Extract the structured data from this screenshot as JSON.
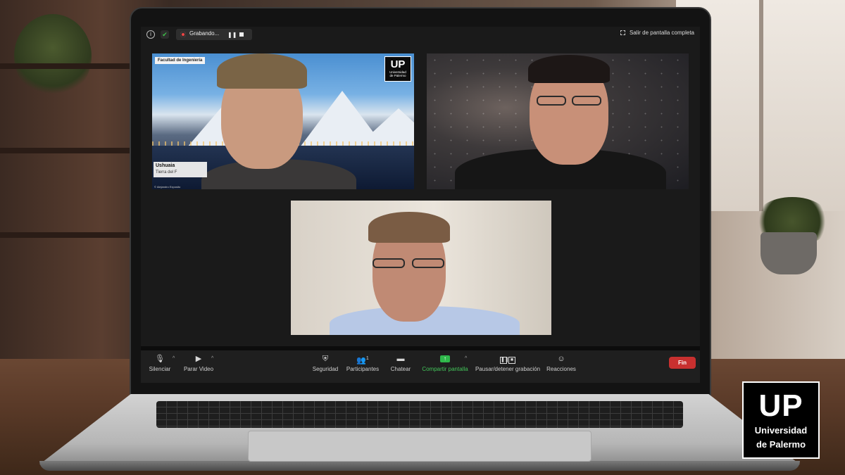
{
  "topbar": {
    "recording_label": "Grabando...",
    "exit_fullscreen_label": "Salir de pantalla completa"
  },
  "tiles": {
    "host_overlay": {
      "faculty_label": "Facultad de Ingeniería",
      "logo_mark": "UP",
      "logo_name_line1": "Universidad",
      "logo_name_line2": "de Palermo",
      "place_title": "Ushuaia",
      "place_subtitle": "Tierra del F",
      "photo_credit": "© Alejandro Exposito"
    }
  },
  "toolbar": {
    "mute_label": "Silenciar",
    "stop_video_label": "Parar Video",
    "security_label": "Seguridad",
    "participants_label": "Participantes",
    "participants_count": "1",
    "chat_label": "Chatear",
    "share_label": "Compartir pantalla",
    "pause_recording_label": "Pausar/detener grabación",
    "reactions_label": "Reacciones",
    "end_label": "Fin"
  },
  "brand": {
    "mark": "UP",
    "name_line1": "Universidad",
    "name_line2": "de Palermo"
  },
  "colors": {
    "share_accent": "#43c55a",
    "end_button": "#c8302f",
    "security_shield": "#3ec04a"
  }
}
